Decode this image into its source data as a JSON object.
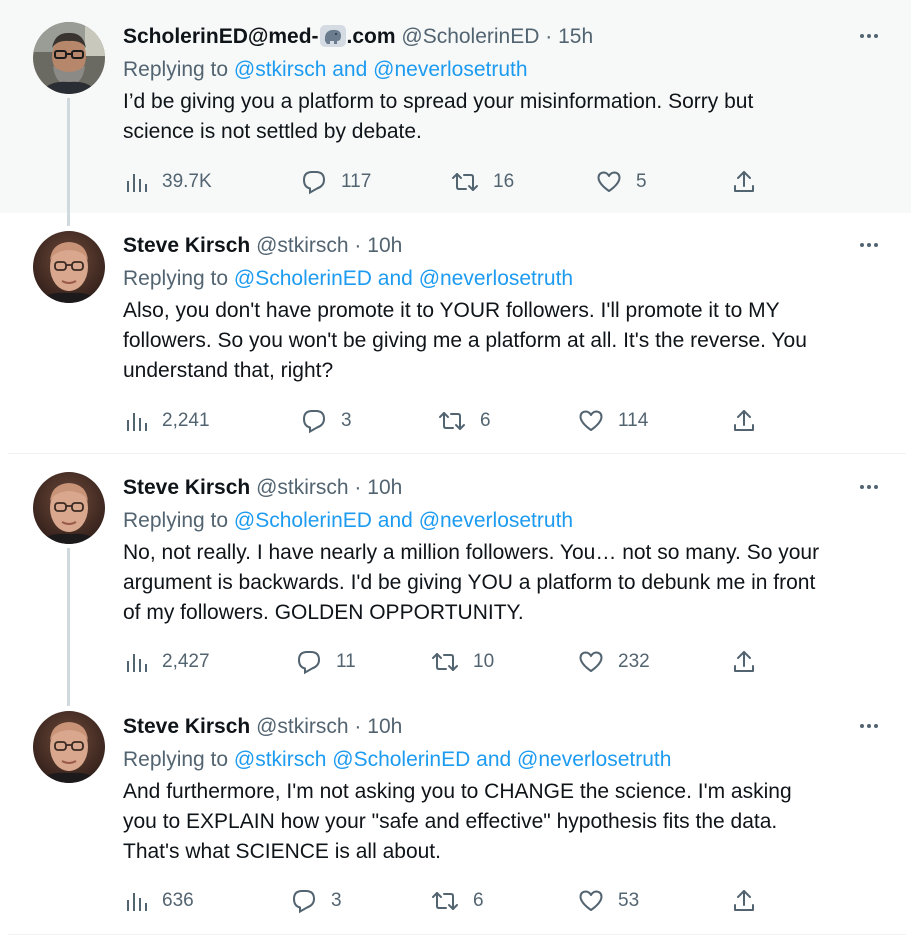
{
  "tweets": [
    {
      "name_part1": "ScholerinED@med-",
      "name_part2": ".com",
      "handle": "@ScholerinED",
      "dot": "·",
      "time": "15h",
      "replying_label": "Replying to",
      "mention_a": "@stkirsch",
      "and_label": "and",
      "mention_b": "@neverlosetruth",
      "lines": [
        "I’d be giving you a platform to spread your misinformation. Sorry but",
        "science is not settled by debate."
      ],
      "views": "39.7K",
      "replies": "117",
      "retweets": "16",
      "likes": "5"
    },
    {
      "name": "Steve Kirsch",
      "handle": "@stkirsch",
      "dot": "·",
      "time": "10h",
      "replying_label": "Replying to",
      "mention_a": "@ScholerinED",
      "and_label": "and",
      "mention_b": "@neverlosetruth",
      "lines": [
        "Also, you don't have promote it to YOUR followers. I'll promote it to MY",
        "followers. So you won't be giving me a platform at all. It's the reverse. You",
        "understand that, right?"
      ],
      "views": "2,241",
      "replies": "3",
      "retweets": "6",
      "likes": "114"
    },
    {
      "name": "Steve Kirsch",
      "handle": "@stkirsch",
      "dot": "·",
      "time": "10h",
      "replying_label": "Replying to",
      "mention_a": "@ScholerinED",
      "and_label": "and",
      "mention_b": "@neverlosetruth",
      "lines": [
        "No, not really. I have nearly a million followers. You… not so many. So your",
        "argument is backwards. I'd be giving YOU a platform to debunk me in front",
        "of my followers. GOLDEN OPPORTUNITY."
      ],
      "views": "2,427",
      "replies": "11",
      "retweets": "10",
      "likes": "232"
    },
    {
      "name": "Steve Kirsch",
      "handle": "@stkirsch",
      "dot": "·",
      "time": "10h",
      "replying_label": "Replying to",
      "mention_a": "@stkirsch",
      "mention_mid": "@ScholerinED",
      "and_label": "and",
      "mention_b": "@neverlosetruth",
      "lines": [
        "And furthermore, I'm not asking you to CHANGE the science. I'm asking",
        "you to EXPLAIN how your \"safe and effective\" hypothesis fits the data.",
        "That's what SCIENCE is all about."
      ],
      "views": "636",
      "replies": "3",
      "retweets": "6",
      "likes": "53"
    }
  ],
  "icons": {
    "views": "bar-chart-icon",
    "reply": "speech-bubble-icon",
    "retweet": "retweet-icon",
    "like": "heart-icon",
    "share": "share-upload-icon",
    "more": "more-dots-icon"
  },
  "colors": {
    "link": "#1d9bf0",
    "muted": "#536471",
    "text": "#0f1419",
    "highlight_bg": "#f7f9f9"
  }
}
